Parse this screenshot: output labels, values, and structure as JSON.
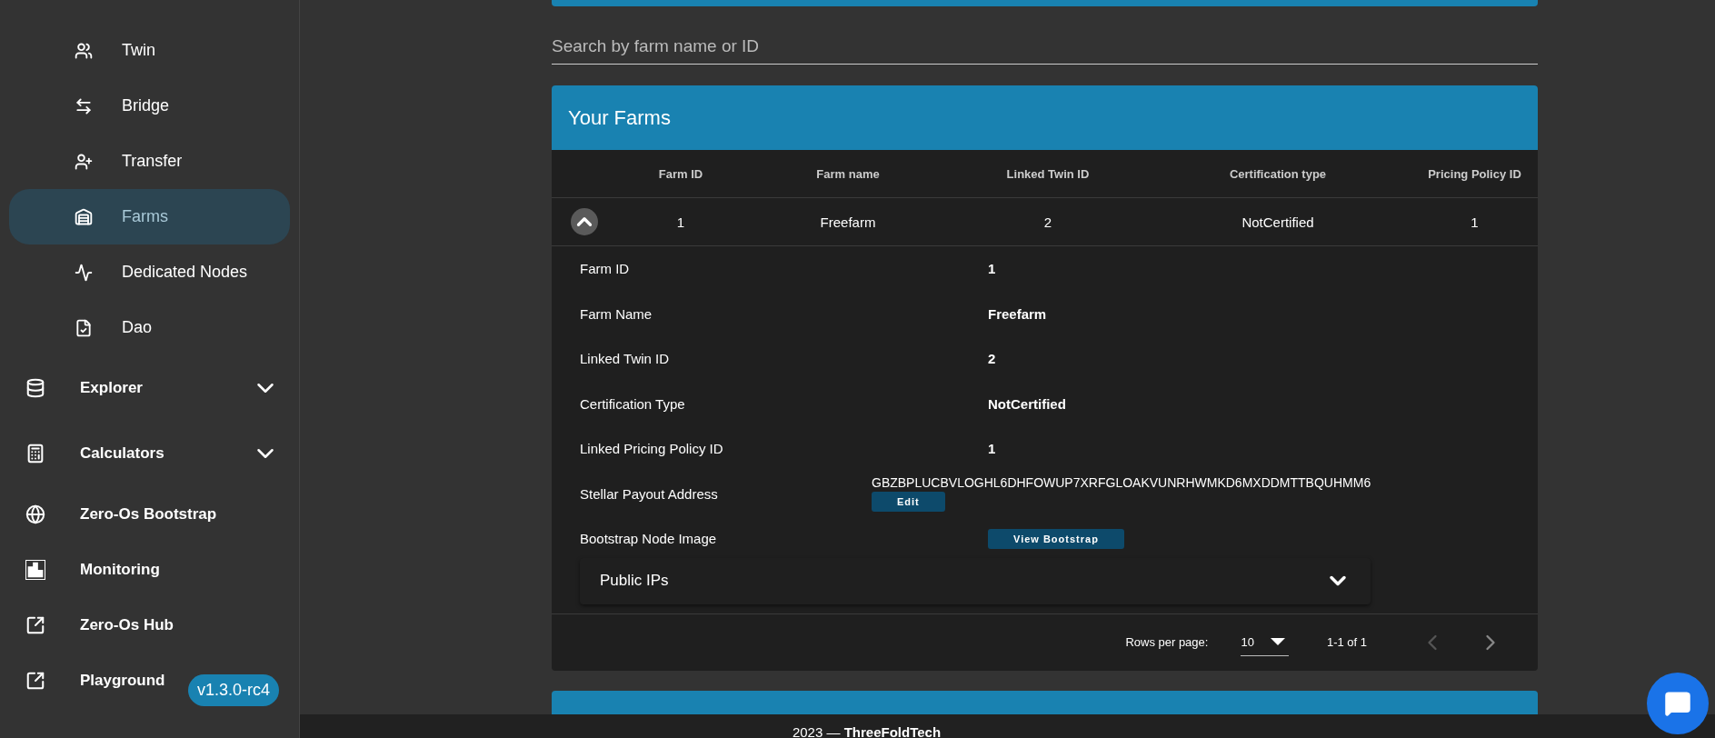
{
  "sidebar": {
    "items": [
      {
        "kind": "sub",
        "label": "Twin",
        "selected": false
      },
      {
        "kind": "sub",
        "label": "Bridge",
        "selected": false
      },
      {
        "kind": "sub",
        "label": "Transfer",
        "selected": false
      },
      {
        "kind": "sub",
        "label": "Farms",
        "selected": true
      },
      {
        "kind": "sub",
        "label": "Dedicated Nodes",
        "selected": false
      },
      {
        "kind": "sub",
        "label": "Dao",
        "selected": false
      },
      {
        "kind": "group",
        "label": "Explorer",
        "expanded": false,
        "selected": false
      },
      {
        "kind": "group",
        "label": "Calculators",
        "expanded": false,
        "selected": false
      },
      {
        "kind": "link",
        "label": "Zero-Os Bootstrap",
        "selected": false
      },
      {
        "kind": "link",
        "label": "Monitoring",
        "selected": false
      },
      {
        "kind": "link",
        "label": "Zero-Os Hub",
        "selected": false
      },
      {
        "kind": "link",
        "label": "Playground",
        "selected": false
      }
    ],
    "version": "v1.3.0-rc4"
  },
  "search": {
    "placeholder": "Search by farm name or ID"
  },
  "farms": {
    "title": "Your Farms",
    "columns": [
      "Farm ID",
      "Farm name",
      "Linked Twin ID",
      "Certification type",
      "Pricing Policy ID"
    ],
    "rows": [
      {
        "expanded": true,
        "cells": [
          "1",
          "Freefarm",
          "2",
          "NotCertified",
          "1"
        ]
      }
    ],
    "details": [
      {
        "kind": "text",
        "label": "Farm ID",
        "value": "1"
      },
      {
        "kind": "text",
        "label": "Farm Name",
        "value": "Freefarm"
      },
      {
        "kind": "text",
        "label": "Linked Twin ID",
        "value": "2"
      },
      {
        "kind": "text",
        "label": "Certification Type",
        "value": "NotCertified"
      },
      {
        "kind": "text",
        "label": "Linked Pricing Policy ID",
        "value": "1"
      },
      {
        "kind": "address",
        "label": "Stellar Payout Address",
        "value": "GBZBPLUCBVLOGHL6DHFOWUP7XRFGLOAKVUNRHWMKD6MXDDMTTBQUHMM6",
        "button": "Edit"
      },
      {
        "kind": "button",
        "label": "Bootstrap Node Image",
        "button": "View Bootstrap"
      }
    ],
    "public_ips": {
      "label": "Public IPs",
      "expanded": false
    },
    "pagination": {
      "rows_per_page_label": "Rows per page:",
      "rows_per_page": "10",
      "range": "1-1 of 1"
    }
  },
  "footer": {
    "text": "2023 — **ThreeFoldTech**"
  }
}
